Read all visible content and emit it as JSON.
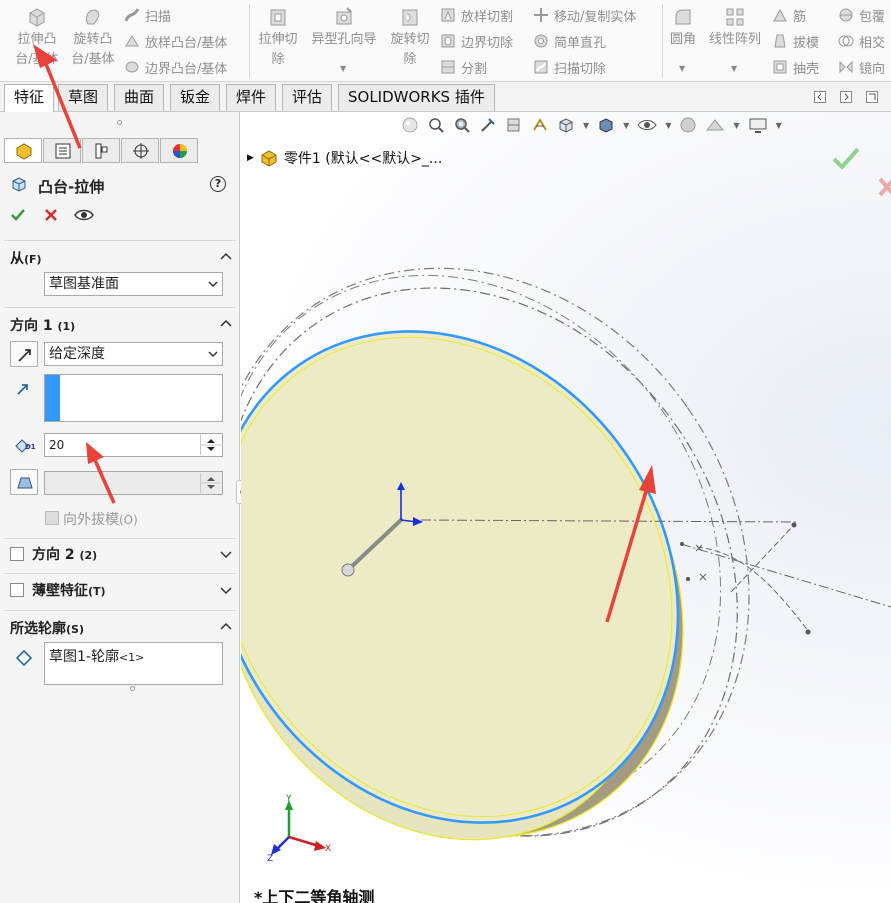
{
  "ribbon": {
    "extrude_boss": {
      "line1": "拉伸凸",
      "line2": "台/基体"
    },
    "revolve_boss": {
      "line1": "旋转凸",
      "line2": "台/基体"
    },
    "sweep": "扫描",
    "loft_boss": "放样凸台/基体",
    "boundary_boss": "边界凸台/基体",
    "extrude_cut": {
      "line1": "拉伸切",
      "line2": "除"
    },
    "hole_wizard": "异型孔向导",
    "revolve_cut": {
      "line1": "旋转切",
      "line2": "除"
    },
    "loft_cut": "放样切割",
    "boundary_cut": "边界切除",
    "split": "分割",
    "move_copy_body": "移动/复制实体",
    "simple_hole": "简单直孔",
    "sweep_cut": "扫描切除",
    "fillet": "圆角",
    "linear_pattern": "线性阵列",
    "rib": "筋",
    "draft": "拔模",
    "shell": "抽壳",
    "wrap": "包覆",
    "intersect": "相交",
    "mirror": "镜向"
  },
  "tabs": [
    "特征",
    "草图",
    "曲面",
    "钣金",
    "焊件",
    "评估",
    "SOLIDWORKS 插件"
  ],
  "active_tab": "特征",
  "panel": {
    "feature_title": "凸台-拉伸",
    "help_symbol": "?",
    "from": {
      "title": "从",
      "shortcut": "(F)",
      "value": "草图基准面"
    },
    "direction1": {
      "title": "方向 1",
      "shortcut": "(1)",
      "end_condition": "给定深度",
      "depth": "20",
      "depth_icon_label": "D1",
      "draft_outward": "向外拔模",
      "draft_outward_shortcut": "(O)"
    },
    "direction2": {
      "title": "方向 2",
      "shortcut": "(2)"
    },
    "thin_feature": {
      "title": "薄壁特征",
      "shortcut": "(T)"
    },
    "selected_contours": {
      "title": "所选轮廓",
      "shortcut": "(S)",
      "item": "草图1-轮廓",
      "item_suffix": "<1>"
    }
  },
  "viewport": {
    "tree_label": "零件1  (默认<<默认>_...",
    "view_name": "*上下二等角轴测",
    "triad": {
      "x": "X",
      "y": "Y",
      "z": "Z"
    }
  },
  "colors": {
    "accent_blue": "#3399ff",
    "annotation_red": "#e8433a",
    "ok_green": "#3a9a3a",
    "cancel_red": "#d42a2a",
    "face_yellow": "#ededc8"
  }
}
